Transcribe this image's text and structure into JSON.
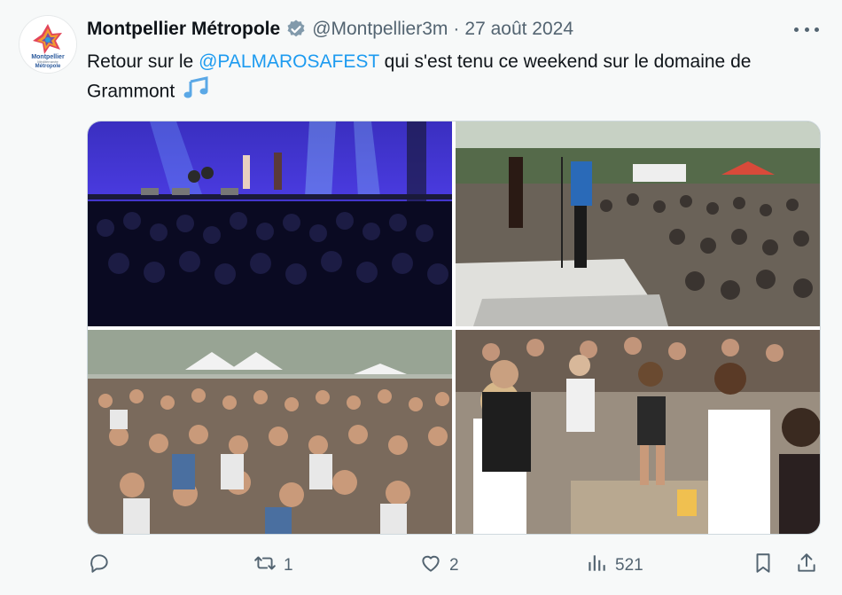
{
  "author": {
    "name": "Montpellier Métropole",
    "handle": "@Montpellier3m",
    "separator": "·",
    "date": "27 août 2024",
    "avatar_lines": [
      "Montpellier",
      "Méditerranée",
      "Métropole"
    ]
  },
  "post": {
    "text_before": "Retour sur le ",
    "mention": "@PALMAROSAFEST",
    "text_after": " qui s'est tenu ce weekend sur le domaine de Grammont",
    "emoji": "🎶"
  },
  "actions": {
    "replies": "",
    "reposts": "1",
    "likes": "2",
    "views": "521"
  },
  "icons": [
    "verified-badge-icon",
    "more-icon",
    "reply-icon",
    "repost-icon",
    "like-icon",
    "views-icon",
    "bookmark-icon",
    "share-icon"
  ],
  "colors": {
    "accent": "#1d9bf0",
    "muted": "#536471",
    "text": "#0f1419"
  }
}
